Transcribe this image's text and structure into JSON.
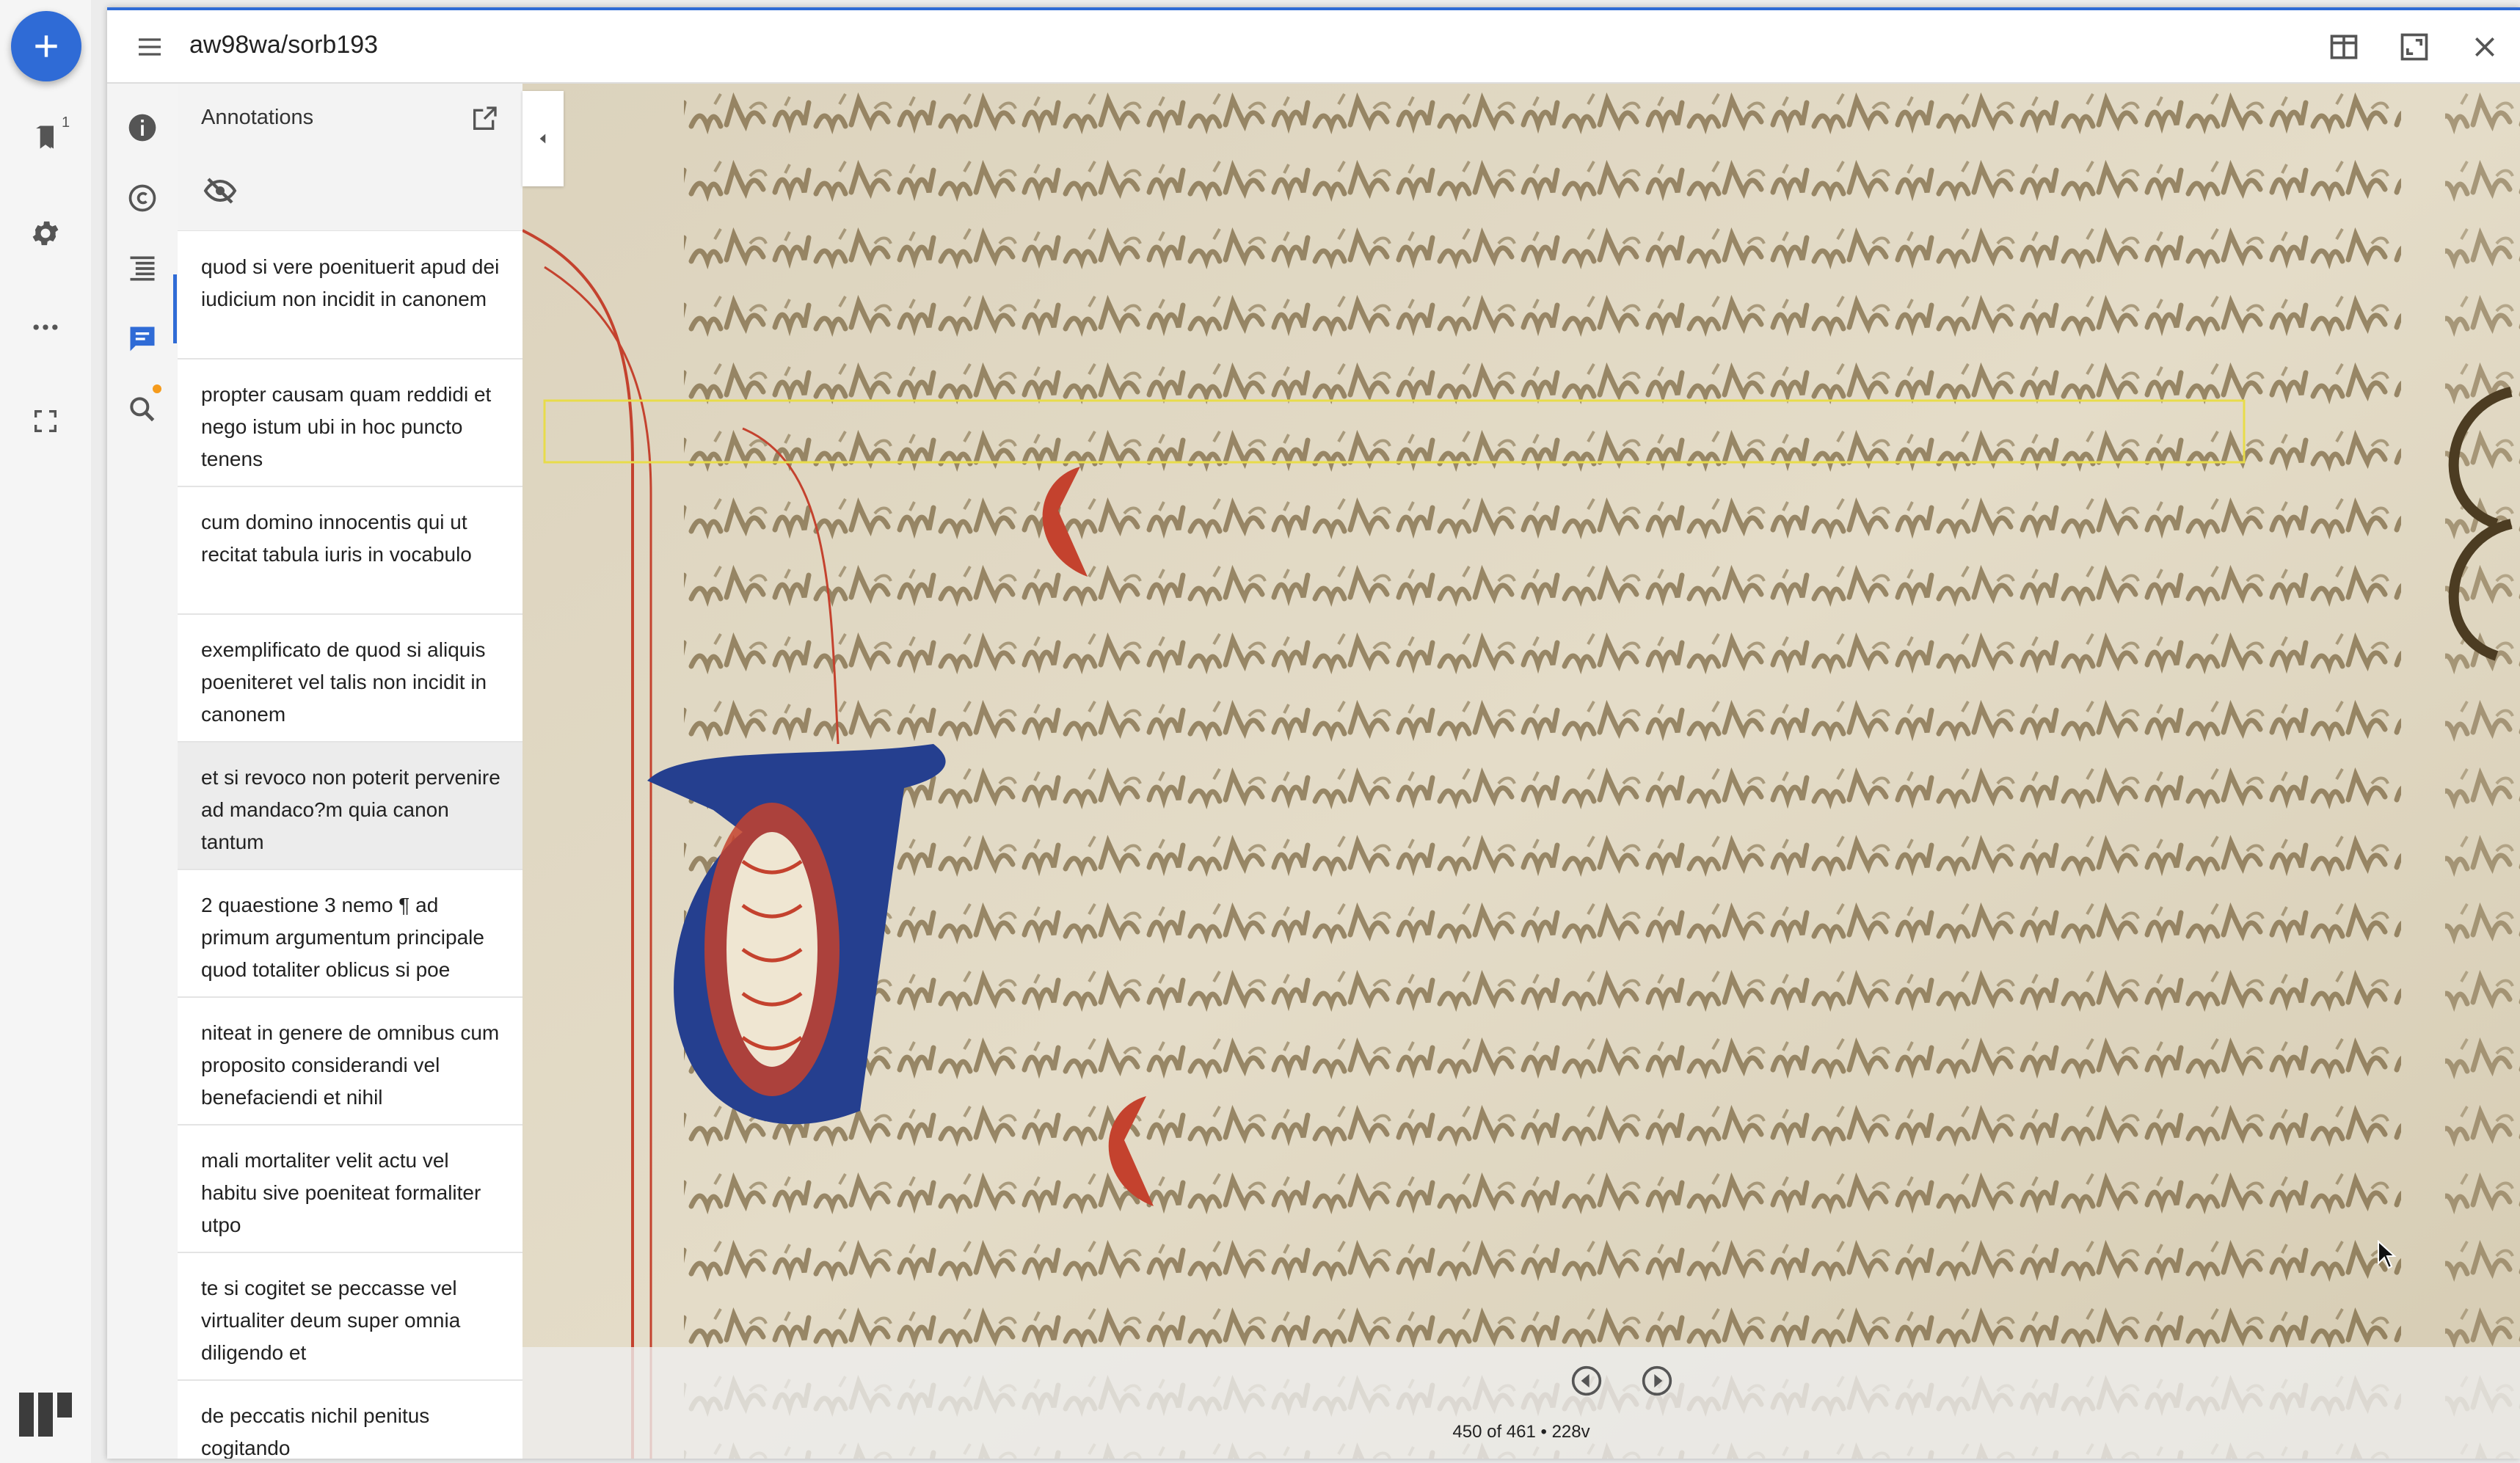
{
  "window": {
    "title": "aw98wa/sorb193"
  },
  "rail": {
    "bookmark_count": "1"
  },
  "annotations_panel": {
    "title": "Annotations",
    "items": [
      {
        "text": "quod si vere poenituerit apud dei iudicium non incidit in canonem"
      },
      {
        "text": "propter causam quam reddidi et nego istum ubi in hoc puncto tenens"
      },
      {
        "text": "cum domino innocentis qui ut recitat tabula iuris in vocabulo"
      },
      {
        "text": "exemplificato de quod si aliquis poeniteret vel talis non incidit in canonem"
      },
      {
        "text": "et si revoco non poterit pervenire ad mandaco?m quia canon tantum",
        "selected": true
      },
      {
        "text": "2 quaestione 3 nemo ¶ ad primum argumentum principale quod totaliter oblicus si poe"
      },
      {
        "text": "niteat in genere de omnibus cum proposito considerandi vel benefaciendi et nihil"
      },
      {
        "text": "mali mortaliter velit actu vel habitu sive poeniteat formaliter utpo"
      },
      {
        "text": "te si cogitet se peccasse vel virtualiter deum super omnia diligendo et"
      },
      {
        "text": "de peccatis nichil penitus cogitando"
      }
    ]
  },
  "viewer": {
    "page_indicator": "450 of 461 • 228v",
    "highlight_color": "#e8dc4a"
  },
  "icons": {
    "add": "plus-icon",
    "bookmarks": "bookmark-icon",
    "settings": "gear-icon",
    "more": "more-horiz-icon",
    "fullscreen": "fullscreen-icon",
    "menu": "menu-icon",
    "layout": "book-layout-icon",
    "maximize": "maximize-icon",
    "close": "close-icon",
    "info": "info-icon",
    "rights": "copyright-icon",
    "index": "list-icon",
    "annotations": "annotation-icon",
    "search": "search-icon",
    "popout": "open-in-new-icon",
    "visibility": "visibility-off-icon",
    "collapse": "chevron-left-icon",
    "previous": "previous-icon",
    "next": "next-icon"
  },
  "colors": {
    "accent": "#2f6bd6",
    "notification": "#f59b1c",
    "ink": "#6e5a36",
    "rubric": "#c4422e",
    "initial": "#253f8f"
  }
}
